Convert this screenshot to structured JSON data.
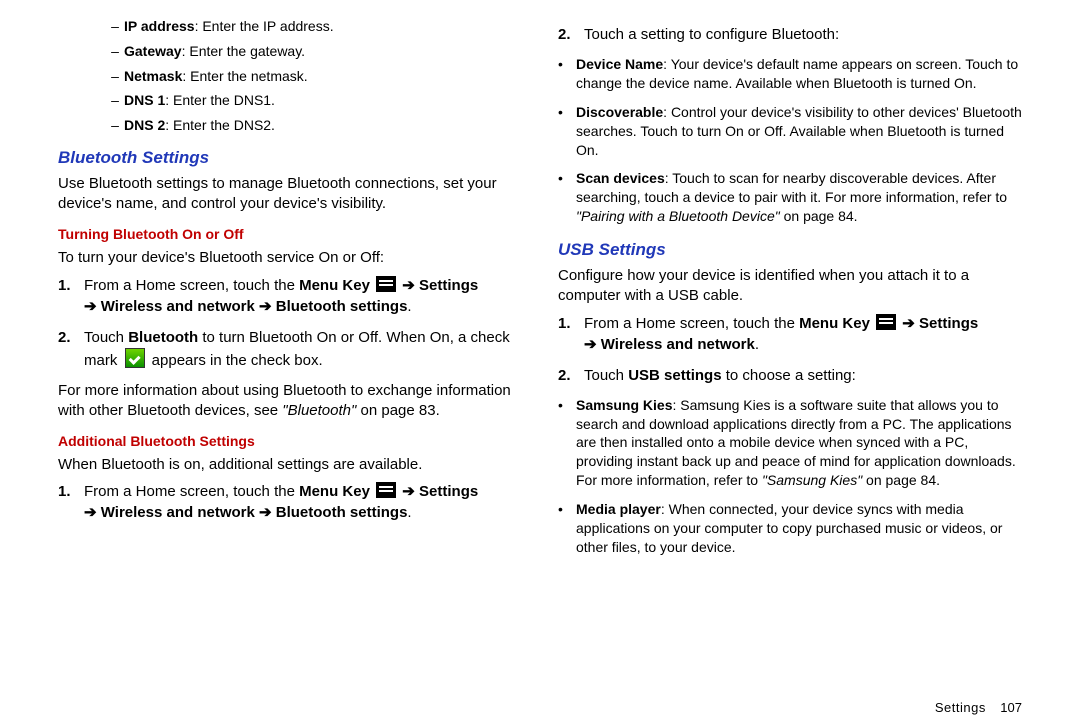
{
  "left": {
    "dash_items": [
      {
        "term": "IP address",
        "desc": ": Enter the IP address."
      },
      {
        "term": "Gateway",
        "desc": ": Enter the gateway."
      },
      {
        "term": "Netmask",
        "desc": ": Enter the netmask."
      },
      {
        "term": "DNS 1",
        "desc": ": Enter the DNS1."
      },
      {
        "term": "DNS 2",
        "desc": ": Enter the DNS2."
      }
    ],
    "bt_heading": "Bluetooth Settings",
    "bt_intro": "Use Bluetooth settings to manage Bluetooth connections, set your device's name, and control your device's visibility.",
    "turn_heading": "Turning Bluetooth On or Off",
    "turn_intro": "To turn your device's Bluetooth service On or Off:",
    "step1_pre": "From a Home screen, touch the ",
    "step1_menukey": "Menu Key",
    "step1_settings": "Settings",
    "step1_line2_a": "Wireless and network",
    "step1_line2_b": "Bluetooth settings",
    "step2_a": "Touch ",
    "step2_bt": "Bluetooth",
    "step2_b": " to turn Bluetooth On or Off. When On, a check mark ",
    "step2_c": " appears in the check box.",
    "more_a": "For more information about using Bluetooth to exchange information with other Bluetooth devices, see ",
    "more_q": "\"Bluetooth\"",
    "more_b": " on page 83.",
    "addl_heading": "Additional Bluetooth Settings",
    "addl_intro": "When Bluetooth is on, additional settings are available.",
    "addl_step1_pre": "From a Home screen, touch the ",
    "addl_step1_menukey": "Menu Key",
    "addl_step1_settings": "Settings",
    "addl_step1_line2_a": "Wireless and network",
    "addl_step1_line2_b": "Bluetooth settings"
  },
  "right": {
    "num2": "2.",
    "step2_intro": "Touch a setting to configure Bluetooth:",
    "bullets_bt": [
      {
        "term": "Device Name",
        "desc": ": Your device's default name appears on screen. Touch to change the device name. Available when Bluetooth is turned On."
      },
      {
        "term": "Discoverable",
        "desc": ": Control your device's visibility to other devices' Bluetooth searches. Touch to turn On or Off. Available when Bluetooth is turned On."
      },
      {
        "term": "Scan devices",
        "desc": ": Touch to scan for nearby discoverable devices. After searching, touch a device to pair with it. For more information, refer to ",
        "quote": "\"Pairing with a Bluetooth Device\"",
        "tail": "  on page 84."
      }
    ],
    "usb_heading": "USB Settings",
    "usb_intro": "Configure how your device is identified when you attach it to a computer with a USB cable.",
    "usb_step1_pre": "From a Home screen, touch the ",
    "usb_step1_menukey": "Menu Key",
    "usb_step1_settings": "Settings",
    "usb_step1_line2": "Wireless and network",
    "usb_step2_a": "Touch ",
    "usb_step2_bold": "USB settings",
    "usb_step2_b": " to choose a setting:",
    "bullets_usb": [
      {
        "term": "Samsung Kies",
        "desc": ": Samsung Kies is a software suite that allows you to search and download applications directly from a PC. The applications are then installed onto a mobile device when synced with a PC, providing instant back up and peace of mind for application downloads. For more information, refer to ",
        "quote": "\"Samsung Kies\"",
        "tail": "  on page 84."
      },
      {
        "term": "Media player",
        "desc": ": When connected, your device syncs with media applications on your computer to copy purchased music or videos, or other files, to your device."
      }
    ]
  },
  "footer": {
    "label": "Settings",
    "page": "107"
  }
}
